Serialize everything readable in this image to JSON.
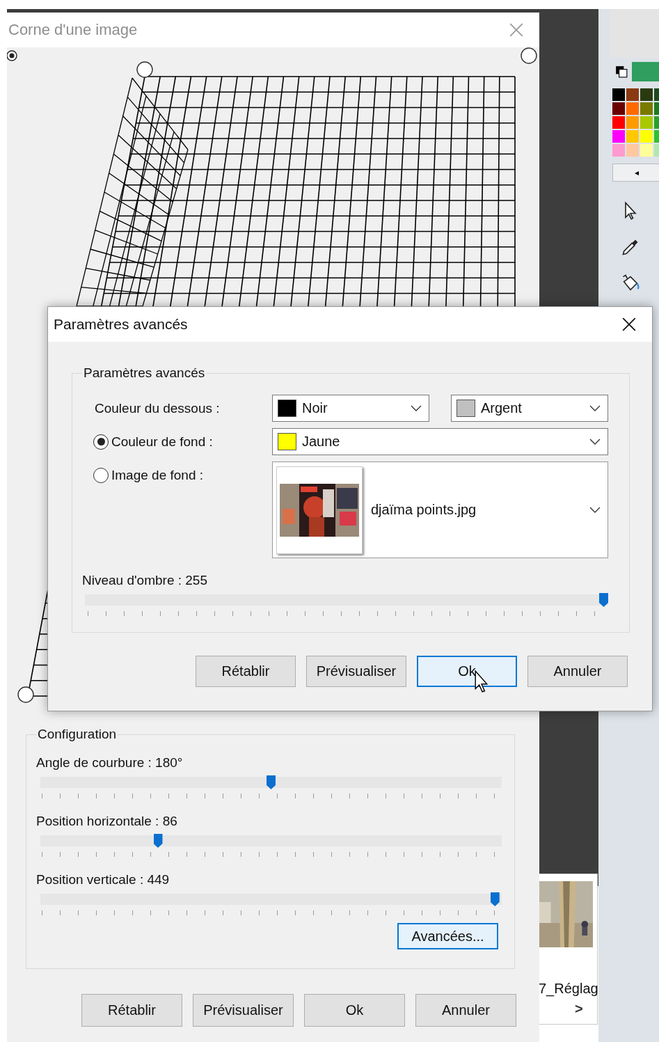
{
  "main_dialog": {
    "title": "Corne d'une image",
    "configuration": {
      "title": "Configuration",
      "sliders": [
        {
          "label": "Angle de courbure : 180°",
          "level": 0.5
        },
        {
          "label": "Position horizontale : 86",
          "level": 0.25
        },
        {
          "label": "Position verticale : 449",
          "level": 0.995
        }
      ],
      "advanced_button": "Avancées..."
    },
    "buttons": [
      {
        "label": "Rétablir",
        "focused": false
      },
      {
        "label": "Prévisualiser",
        "focused": false
      },
      {
        "label": "Ok",
        "focused": false
      },
      {
        "label": "Annuler",
        "focused": false
      }
    ]
  },
  "advanced_dialog": {
    "title": "Paramètres avancés",
    "group_title": "Paramètres avancés",
    "underside": {
      "label": "Couleur du dessous :",
      "colors": [
        {
          "name": "Noir",
          "color": "#000000"
        },
        {
          "name": "Argent",
          "color": "#c0c0c0"
        }
      ]
    },
    "background_options": [
      {
        "label": "Couleur de fond :",
        "selected": true,
        "kind": "color",
        "value": "Jaune",
        "color": "#ffff00"
      },
      {
        "label": "Image de fond :",
        "selected": false,
        "value": "djaïma points.jpg"
      }
    ],
    "shadow": {
      "label": "Niveau d'ombre : 255",
      "level": 1
    },
    "buttons": [
      {
        "label": "Rétablir",
        "focused": false
      },
      {
        "label": "Prévisualiser",
        "focused": false
      },
      {
        "label": "Ok",
        "focused": true
      },
      {
        "label": "Annuler",
        "focused": false
      }
    ]
  },
  "thumbnail_panel": {
    "caption": "7_Réglag",
    "next": ">"
  },
  "tool_panel": {
    "scroll_left": "◂"
  }
}
